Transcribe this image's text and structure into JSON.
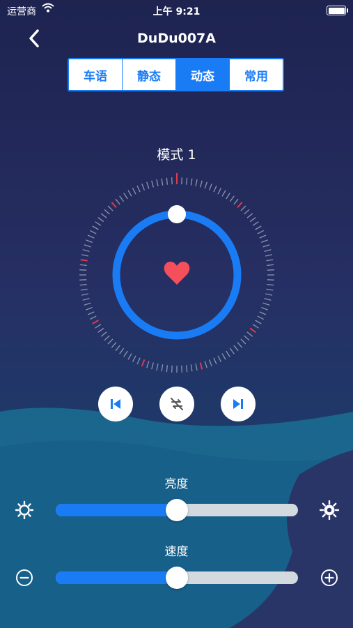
{
  "status_bar": {
    "carrier": "运营商",
    "time": "上午 9:21",
    "battery_level": 1.0
  },
  "nav": {
    "title": "DuDu007A",
    "back_icon": "chevron-left-icon"
  },
  "tabs": [
    {
      "label": "车语",
      "active": false
    },
    {
      "label": "静态",
      "active": false
    },
    {
      "label": "动态",
      "active": true
    },
    {
      "label": "常用",
      "active": false
    }
  ],
  "mode": {
    "label": "模式 1"
  },
  "dial": {
    "center_icon": "heart-icon",
    "ring_position": 0.0
  },
  "controls": {
    "prev_icon": "skip-previous-icon",
    "loop_icon": "repeat-off-icon",
    "next_icon": "skip-next-icon"
  },
  "brightness": {
    "label": "亮度",
    "value": 0.5,
    "min_icon": "brightness-low-icon",
    "max_icon": "brightness-high-icon"
  },
  "speed": {
    "label": "速度",
    "value": 0.5,
    "min_icon": "minus-circle-icon",
    "max_icon": "plus-circle-icon"
  },
  "colors": {
    "accent": "#1a7cf5",
    "heart": "#f44f5a",
    "track": "#d3dadf",
    "tick": "#8e95b0",
    "tick_red": "#e23a4a"
  }
}
